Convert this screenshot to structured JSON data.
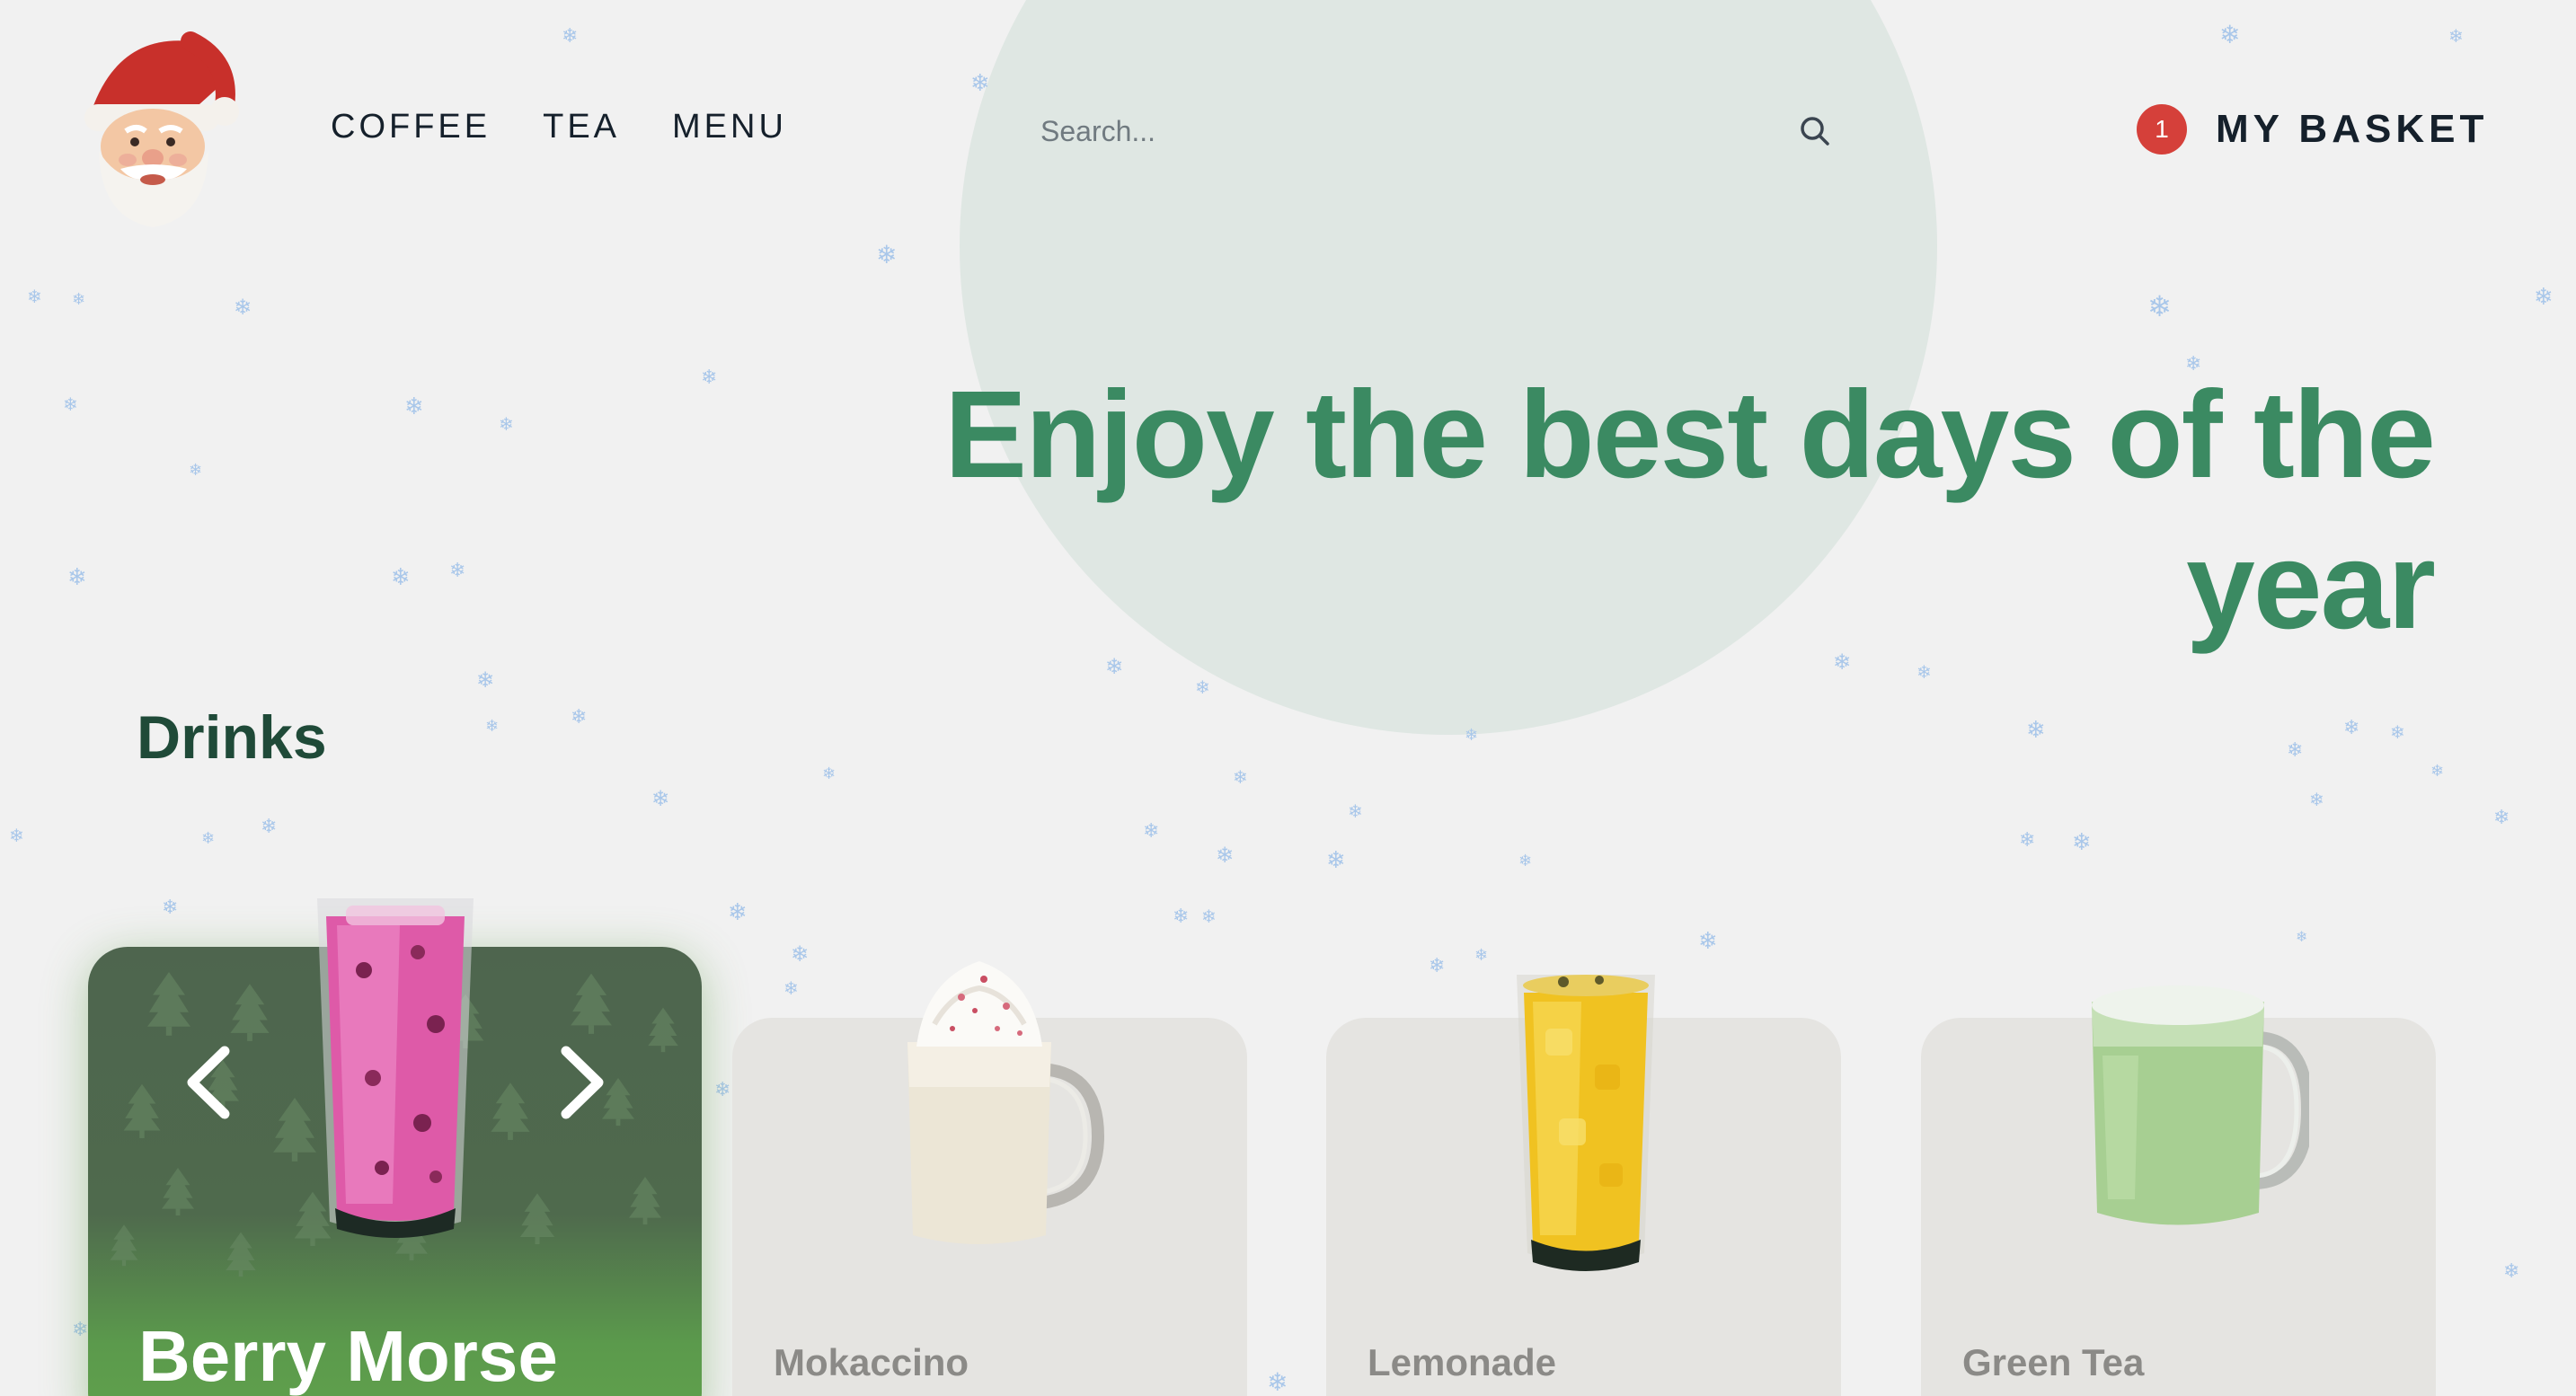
{
  "colors": {
    "background": "#f1f1f1",
    "accent_green": "#3b8a62",
    "section_title": "#1f4a38",
    "badge_red": "#d5403a",
    "featured_card_top": "#4e654e",
    "featured_card_bottom": "#61a14c",
    "plain_card": "#e5e4e1"
  },
  "header": {
    "logo_icon": "santa-claus-logo-icon",
    "nav": [
      {
        "label": "COFFEE"
      },
      {
        "label": "TEA"
      },
      {
        "label": "MENU"
      }
    ],
    "search": {
      "placeholder": "Search...",
      "value": "",
      "icon": "search-icon"
    },
    "basket": {
      "count": "1",
      "label": "MY BASKET"
    }
  },
  "hero": {
    "headline_line1": "Enjoy the best days of the",
    "headline_line2": "year"
  },
  "drinks": {
    "section_title": "Drinks",
    "featured": {
      "name": "Berry Morse",
      "prev_icon": "chevron-left-icon",
      "next_icon": "chevron-right-icon"
    },
    "items": [
      {
        "name": "Mokaccino"
      },
      {
        "name": "Lemonade"
      },
      {
        "name": "Green Tea"
      }
    ]
  }
}
